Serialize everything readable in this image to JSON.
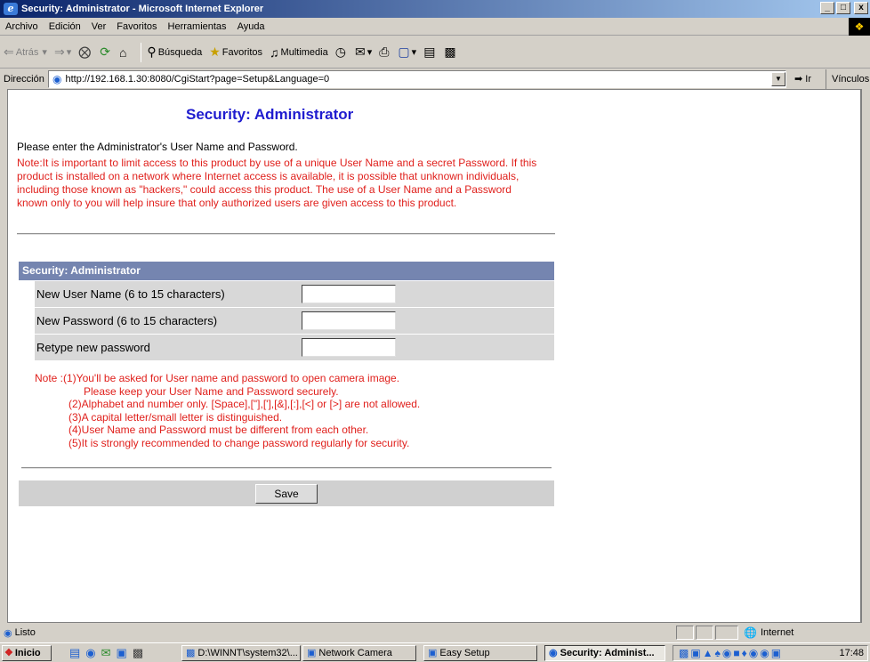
{
  "window": {
    "title": "Security: Administrator - Microsoft Internet Explorer",
    "min": "_",
    "max": "□",
    "close": "x"
  },
  "menu": [
    "Archivo",
    "Edición",
    "Ver",
    "Favoritos",
    "Herramientas",
    "Ayuda"
  ],
  "toolbar": {
    "back": "Atrás",
    "search": "Búsqueda",
    "favorites": "Favoritos",
    "multimedia": "Multimedia"
  },
  "address": {
    "label": "Dirección",
    "url": "http://192.168.1.30:8080/CgiStart?page=Setup&Language=0",
    "go": "Ir",
    "links": "Vínculos"
  },
  "page": {
    "title": "Security: Administrator",
    "intro": "Please enter the Administrator's User Name and Password.",
    "intro_note": "Note:It is important to limit access to this product by use of a unique User Name and a secret Password. If this product is installed on a network where Internet access is available, it is possible that unknown individuals, including those known as \"hackers,\" could access this product. The use of a User Name and a Password known only to you will help insure that only authorized users are given access to this product.",
    "section_header": "Security: Administrator",
    "fields": [
      {
        "label": "New User Name (6 to 15 characters)",
        "value": ""
      },
      {
        "label": "New Password (6 to 15 characters)",
        "value": ""
      },
      {
        "label": "Retype new password",
        "value": ""
      }
    ],
    "notes": [
      "Note :(1)You'll be asked for User name and password to open camera image.",
      "Please keep your User Name and Password securely.",
      "(2)Alphabet and number only. [Space],[\"],['],[&],[:],[<] or [>] are not allowed.",
      "(3)A capital letter/small letter is distinguished.",
      "(4)User Name and Password must be different from each other.",
      "(5)It is strongly recommended to change password regularly for security."
    ],
    "save_label": "Save"
  },
  "status": {
    "text": "Listo",
    "zone": "Internet"
  },
  "taskbar": {
    "start": "Inicio",
    "tasks": [
      {
        "label": "D:\\WINNT\\system32\\...",
        "active": false
      },
      {
        "label": "Network Camera",
        "active": false
      },
      {
        "label": "Easy Setup",
        "active": false
      },
      {
        "label": "Security: Administ...",
        "active": true
      }
    ],
    "clock": "17:48"
  }
}
